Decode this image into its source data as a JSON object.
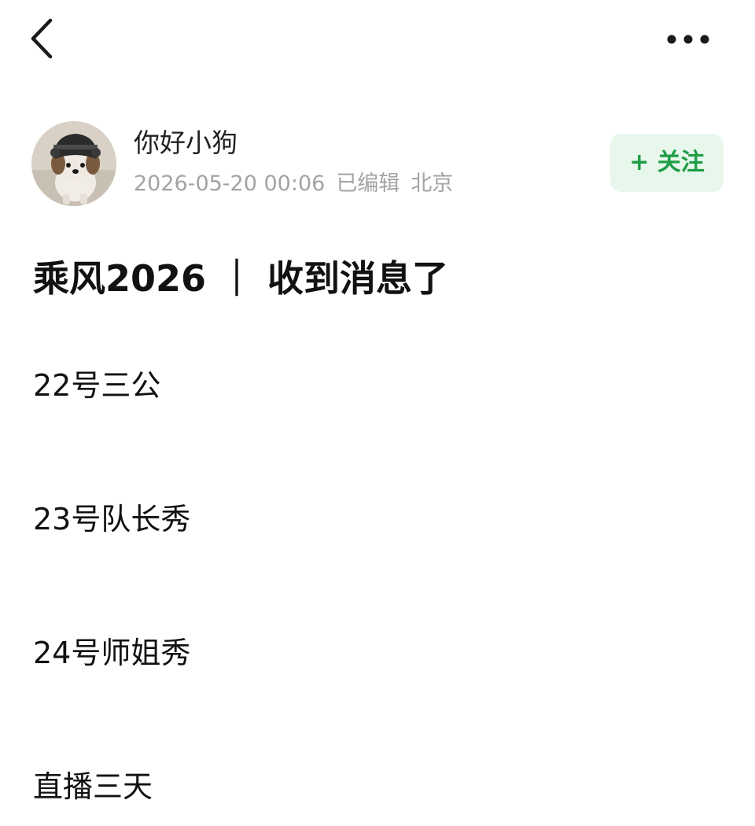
{
  "header": {
    "back_icon": "chevron-left-icon",
    "more_icon": "more-horizontal-icon"
  },
  "author": {
    "avatar": "dog-avatar",
    "name": "你好小狗",
    "date": "2026-05-20 00:06",
    "edited": "已编辑",
    "location": "北京",
    "follow_label": "+ 关注"
  },
  "post": {
    "title": "乘风2026 ｜ 收到消息了",
    "lines": [
      "22号三公",
      "23号队长秀",
      "24号师姐秀",
      "直播三天"
    ]
  },
  "colors": {
    "follow_bg": "#e8f7ec",
    "follow_text": "#1f9d46",
    "meta_text": "#a3a3a3"
  }
}
